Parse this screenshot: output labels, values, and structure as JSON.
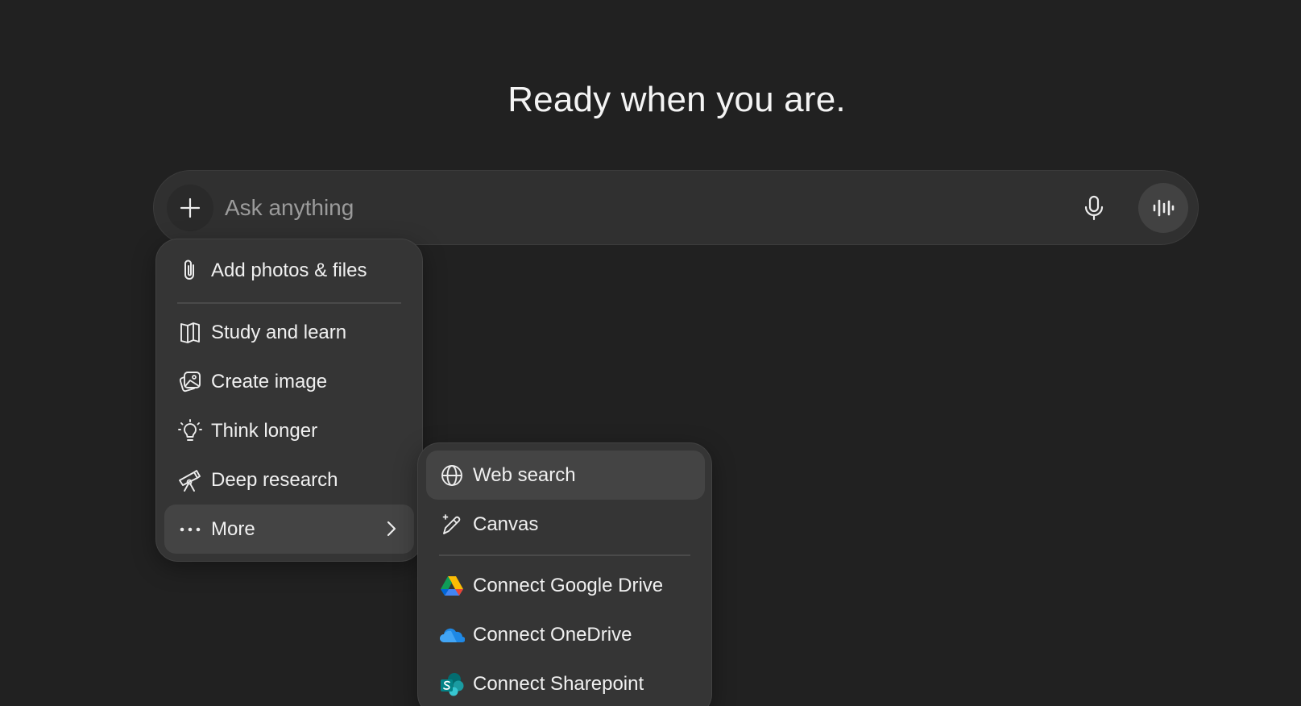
{
  "headline": "Ready when you are.",
  "composer": {
    "placeholder": "Ask anything",
    "add_icon": "plus-icon",
    "mic_icon": "microphone-icon",
    "voice_icon": "voice-mode-icon"
  },
  "menu": {
    "items": [
      {
        "label": "Add photos & files",
        "icon": "paperclip-icon"
      },
      {
        "label": "Study and learn",
        "icon": "book-icon"
      },
      {
        "label": "Create image",
        "icon": "image-icon"
      },
      {
        "label": "Think longer",
        "icon": "lightbulb-icon"
      },
      {
        "label": "Deep research",
        "icon": "telescope-icon"
      },
      {
        "label": "More",
        "icon": "ellipsis-icon"
      }
    ]
  },
  "submenu": {
    "items": [
      {
        "label": "Web search",
        "icon": "globe-icon"
      },
      {
        "label": "Canvas",
        "icon": "canvas-pen-icon"
      },
      {
        "label": "Connect Google Drive",
        "icon": "google-drive-icon"
      },
      {
        "label": "Connect OneDrive",
        "icon": "onedrive-icon"
      },
      {
        "label": "Connect Sharepoint",
        "icon": "sharepoint-icon"
      }
    ]
  },
  "colors": {
    "background": "#212121",
    "composer": "#303030",
    "menu": "#353535",
    "highlight": "#444444",
    "text": "#ececec",
    "placeholder": "#9b9b9b"
  }
}
